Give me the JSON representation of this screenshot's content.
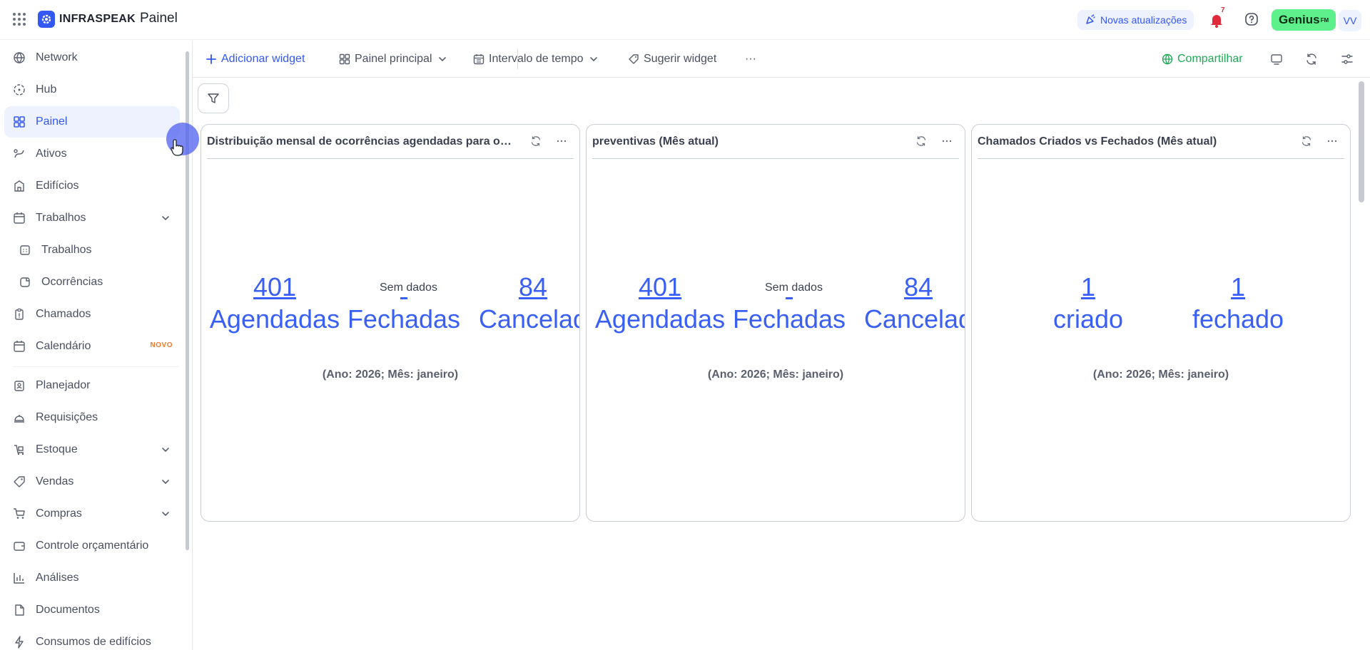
{
  "header": {
    "brand": "INFRASPEAK",
    "page_title": "Painel",
    "updates_label": "Novas atualizações",
    "notifications_count": "7",
    "genius_label": "Genius",
    "genius_sup": "FM",
    "avatar_initials": "VV"
  },
  "sidebar": {
    "items": [
      {
        "label": "Network",
        "icon": "network-icon"
      },
      {
        "label": "Hub",
        "icon": "hub-icon"
      },
      {
        "label": "Painel",
        "icon": "dashboard-icon",
        "active": true
      },
      {
        "label": "Ativos",
        "icon": "assets-icon"
      },
      {
        "label": "Edifícios",
        "icon": "building-icon"
      },
      {
        "label": "Trabalhos",
        "icon": "calendar-check-icon",
        "expandable": true
      },
      {
        "label": "Trabalhos",
        "icon": "calendar-icon",
        "sub": true
      },
      {
        "label": "Ocorrências",
        "icon": "occurrence-icon",
        "sub": true
      },
      {
        "label": "Chamados",
        "icon": "clipboard-icon"
      },
      {
        "label": "Calendário",
        "icon": "calendar-icon",
        "badge": "NOVO"
      },
      {
        "label": "Planejador",
        "icon": "planner-icon"
      },
      {
        "label": "Requisições",
        "icon": "service-bell-icon"
      },
      {
        "label": "Estoque",
        "icon": "stock-icon",
        "expandable": true
      },
      {
        "label": "Vendas",
        "icon": "tag-icon",
        "expandable": true
      },
      {
        "label": "Compras",
        "icon": "cart-icon",
        "expandable": true
      },
      {
        "label": "Controle orçamentário",
        "icon": "wallet-icon"
      },
      {
        "label": "Análises",
        "icon": "bar-chart-icon"
      },
      {
        "label": "Documentos",
        "icon": "document-icon"
      },
      {
        "label": "Consumos de edifícios",
        "icon": "lightning-icon"
      }
    ]
  },
  "toolbar": {
    "add_widget": "Adicionar widget",
    "dashboard_select": "Painel principal",
    "time_interval": "Intervalo de tempo",
    "suggest_widget": "Sugerir widget",
    "more": "···",
    "share": "Compartilhar"
  },
  "cards": [
    {
      "title": "Distribuição mensal de ocorrências agendadas para o i...",
      "kpis": [
        {
          "value": "401",
          "label": "Agendadas"
        },
        {
          "value": "",
          "label": "Fechadas"
        },
        {
          "value": "84",
          "label": "Cancelad"
        }
      ],
      "no_data": "Sem dados",
      "period": "(Ano: 2026; Mês: janeiro)"
    },
    {
      "title": "preventivas (Mês atual)",
      "kpis": [
        {
          "value": "401",
          "label": "Agendadas"
        },
        {
          "value": "",
          "label": "Fechadas"
        },
        {
          "value": "84",
          "label": "Cancelad"
        }
      ],
      "no_data": "Sem dados",
      "period": "(Ano: 2026; Mês: janeiro)"
    },
    {
      "title": "Chamados Criados vs Fechados (Mês atual)",
      "kpis": [
        {
          "value": "1",
          "label": "criado"
        },
        {
          "value": "1",
          "label": "fechado"
        }
      ],
      "period": "(Ano: 2026; Mês: janeiro)"
    }
  ],
  "colors": {
    "accent": "#3358f4",
    "kpi": "#3a5ff5",
    "share": "#1fa855",
    "genius": "#5ef08a",
    "notification": "#e02b3a"
  }
}
